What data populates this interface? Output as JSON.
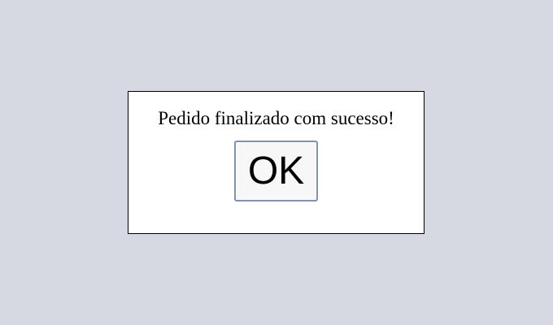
{
  "dialog": {
    "message": "Pedido finalizado com sucesso!",
    "ok_label": "OK"
  },
  "colors": {
    "background": "#d6d9e1",
    "dialog_background": "#ffffff",
    "dialog_border": "#000000",
    "button_border": "#7d93b2",
    "button_background": "#f7f7f7"
  }
}
